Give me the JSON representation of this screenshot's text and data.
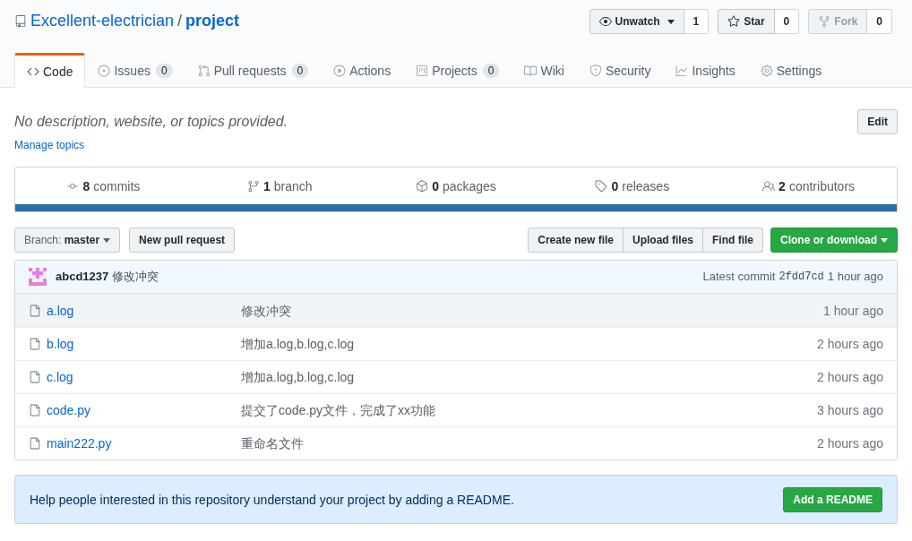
{
  "repo": {
    "owner": "Excellent-electrician",
    "separator": "/",
    "name": "project"
  },
  "header_buttons": [
    {
      "kind": "watch",
      "label": "Unwatch",
      "count": "1",
      "dropdown": true,
      "disabled": false
    },
    {
      "kind": "star",
      "label": "Star",
      "count": "0",
      "dropdown": false,
      "disabled": false
    },
    {
      "kind": "fork",
      "label": "Fork",
      "count": "0",
      "dropdown": false,
      "disabled": true
    }
  ],
  "tabs": [
    {
      "kind": "code",
      "label": "Code",
      "selected": true
    },
    {
      "kind": "issues",
      "label": "Issues",
      "counter": "0",
      "selected": false
    },
    {
      "kind": "pulls",
      "label": "Pull requests",
      "counter": "0",
      "selected": false
    },
    {
      "kind": "actions",
      "label": "Actions",
      "selected": false
    },
    {
      "kind": "projects",
      "label": "Projects",
      "counter": "0",
      "selected": false
    },
    {
      "kind": "wiki",
      "label": "Wiki",
      "selected": false
    },
    {
      "kind": "security",
      "label": "Security",
      "selected": false
    },
    {
      "kind": "insights",
      "label": "Insights",
      "selected": false
    },
    {
      "kind": "settings",
      "label": "Settings",
      "selected": false
    }
  ],
  "description": "No description, website, or topics provided.",
  "edit_button": "Edit",
  "manage_topics": "Manage topics",
  "stats": [
    {
      "kind": "commits",
      "count": "8",
      "label": "commits"
    },
    {
      "kind": "branch",
      "count": "1",
      "label": "branch"
    },
    {
      "kind": "packages",
      "count": "0",
      "label": "packages"
    },
    {
      "kind": "releases",
      "count": "0",
      "label": "releases"
    },
    {
      "kind": "contributors",
      "count": "2",
      "label": "contributors"
    }
  ],
  "branch_button": {
    "label": "Branch:",
    "value": "master"
  },
  "new_pull_request": "New pull request",
  "file_buttons": [
    "Create new file",
    "Upload files",
    "Find file"
  ],
  "clone_button": "Clone or download",
  "latest_commit": {
    "author": "abcd1237",
    "message": "修改冲突",
    "label": "Latest commit",
    "sha": "2fdd7cd",
    "time": "1 hour ago"
  },
  "files": [
    {
      "name": "a.log",
      "message": "修改冲突",
      "time": "1 hour ago",
      "highlighted": true
    },
    {
      "name": "b.log",
      "message": "增加a.log,b.log,c.log",
      "time": "2 hours ago",
      "highlighted": false
    },
    {
      "name": "c.log",
      "message": "增加a.log,b.log,c.log",
      "time": "2 hours ago",
      "highlighted": false
    },
    {
      "name": "code.py",
      "message": "提交了code.py文件，完成了xx功能",
      "time": "3 hours ago",
      "highlighted": false
    },
    {
      "name": "main222.py",
      "message": "重命名文件",
      "time": "2 hours ago",
      "highlighted": false
    }
  ],
  "readme_notice": {
    "text": "Help people interested in this repository understand your project by adding a README.",
    "button": "Add a README"
  }
}
